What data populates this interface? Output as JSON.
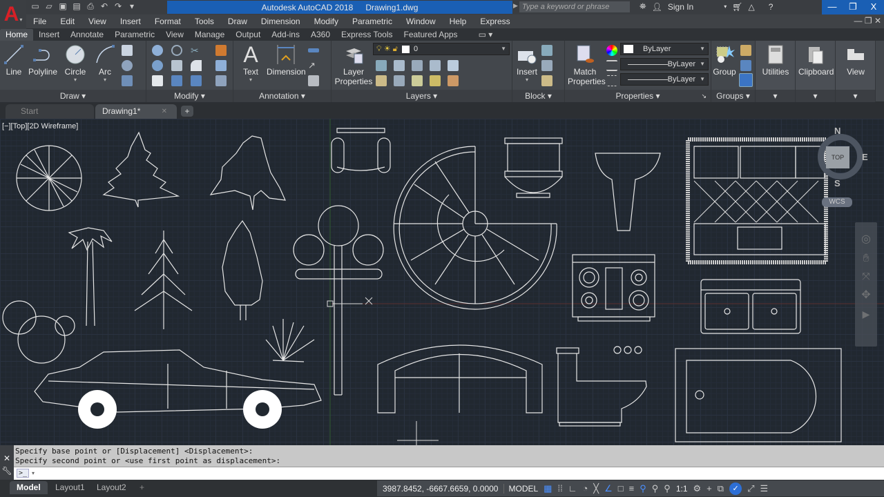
{
  "app": {
    "title": "Autodesk AutoCAD 2018",
    "filename": "Drawing1.dwg",
    "search_placeholder": "Type a keyword or phrase",
    "sign_in": "Sign In",
    "window_controls": [
      "—",
      "❐",
      "X"
    ]
  },
  "quick_access": [
    "new-icon",
    "open-icon",
    "save-icon",
    "saveas-icon",
    "plot-icon",
    "undo-icon",
    "redo-icon",
    "customize-icon"
  ],
  "menubar": [
    "File",
    "Edit",
    "View",
    "Insert",
    "Format",
    "Tools",
    "Draw",
    "Dimension",
    "Modify",
    "Parametric",
    "Window",
    "Help",
    "Express"
  ],
  "ribbon_tabs": [
    "Home",
    "Insert",
    "Annotate",
    "Parametric",
    "View",
    "Manage",
    "Output",
    "Add-ins",
    "A360",
    "Express Tools",
    "Featured Apps"
  ],
  "ribbon_active_tab": "Home",
  "ribbon": {
    "draw": {
      "title": "Draw",
      "tools": [
        "Line",
        "Polyline",
        "Circle",
        "Arc"
      ]
    },
    "modify": {
      "title": "Modify"
    },
    "annotation": {
      "title": "Annotation",
      "tools": [
        "Text",
        "Dimension"
      ]
    },
    "layers": {
      "title": "Layers",
      "layer_properties": "Layer Properties",
      "current_layer": "0"
    },
    "block": {
      "title": "Block",
      "insert": "Insert"
    },
    "properties": {
      "title": "Properties",
      "match": "Match Properties",
      "color": "ByLayer",
      "linetype": "ByLayer",
      "lineweight": "ByLayer"
    },
    "groups": {
      "title": "Groups",
      "group": "Group"
    },
    "utilities": "Utilities",
    "clipboard": "Clipboard",
    "view": "View"
  },
  "doc_tabs": [
    {
      "label": "Start",
      "active": false
    },
    {
      "label": "Drawing1*",
      "active": true
    }
  ],
  "viewport": {
    "label": "[−][Top][2D Wireframe]",
    "viewcube": {
      "top": "TOP",
      "n": "N",
      "s": "S",
      "e": "E",
      "wcs": "WCS"
    }
  },
  "command_line": {
    "history": [
      "Specify base point or [Displacement] <Displacement>:",
      "Specify second point or <use first point as displacement>:"
    ],
    "prompt": ">_"
  },
  "layout_tabs": [
    "Model",
    "Layout1",
    "Layout2"
  ],
  "status": {
    "coordinates": "3987.8452, -6667.6659, 0.0000",
    "space": "MODEL",
    "scale": "1:1"
  },
  "colors": {
    "accent": "#1a5fb4",
    "app_logo": "#d82027",
    "canvas": "#212830"
  }
}
